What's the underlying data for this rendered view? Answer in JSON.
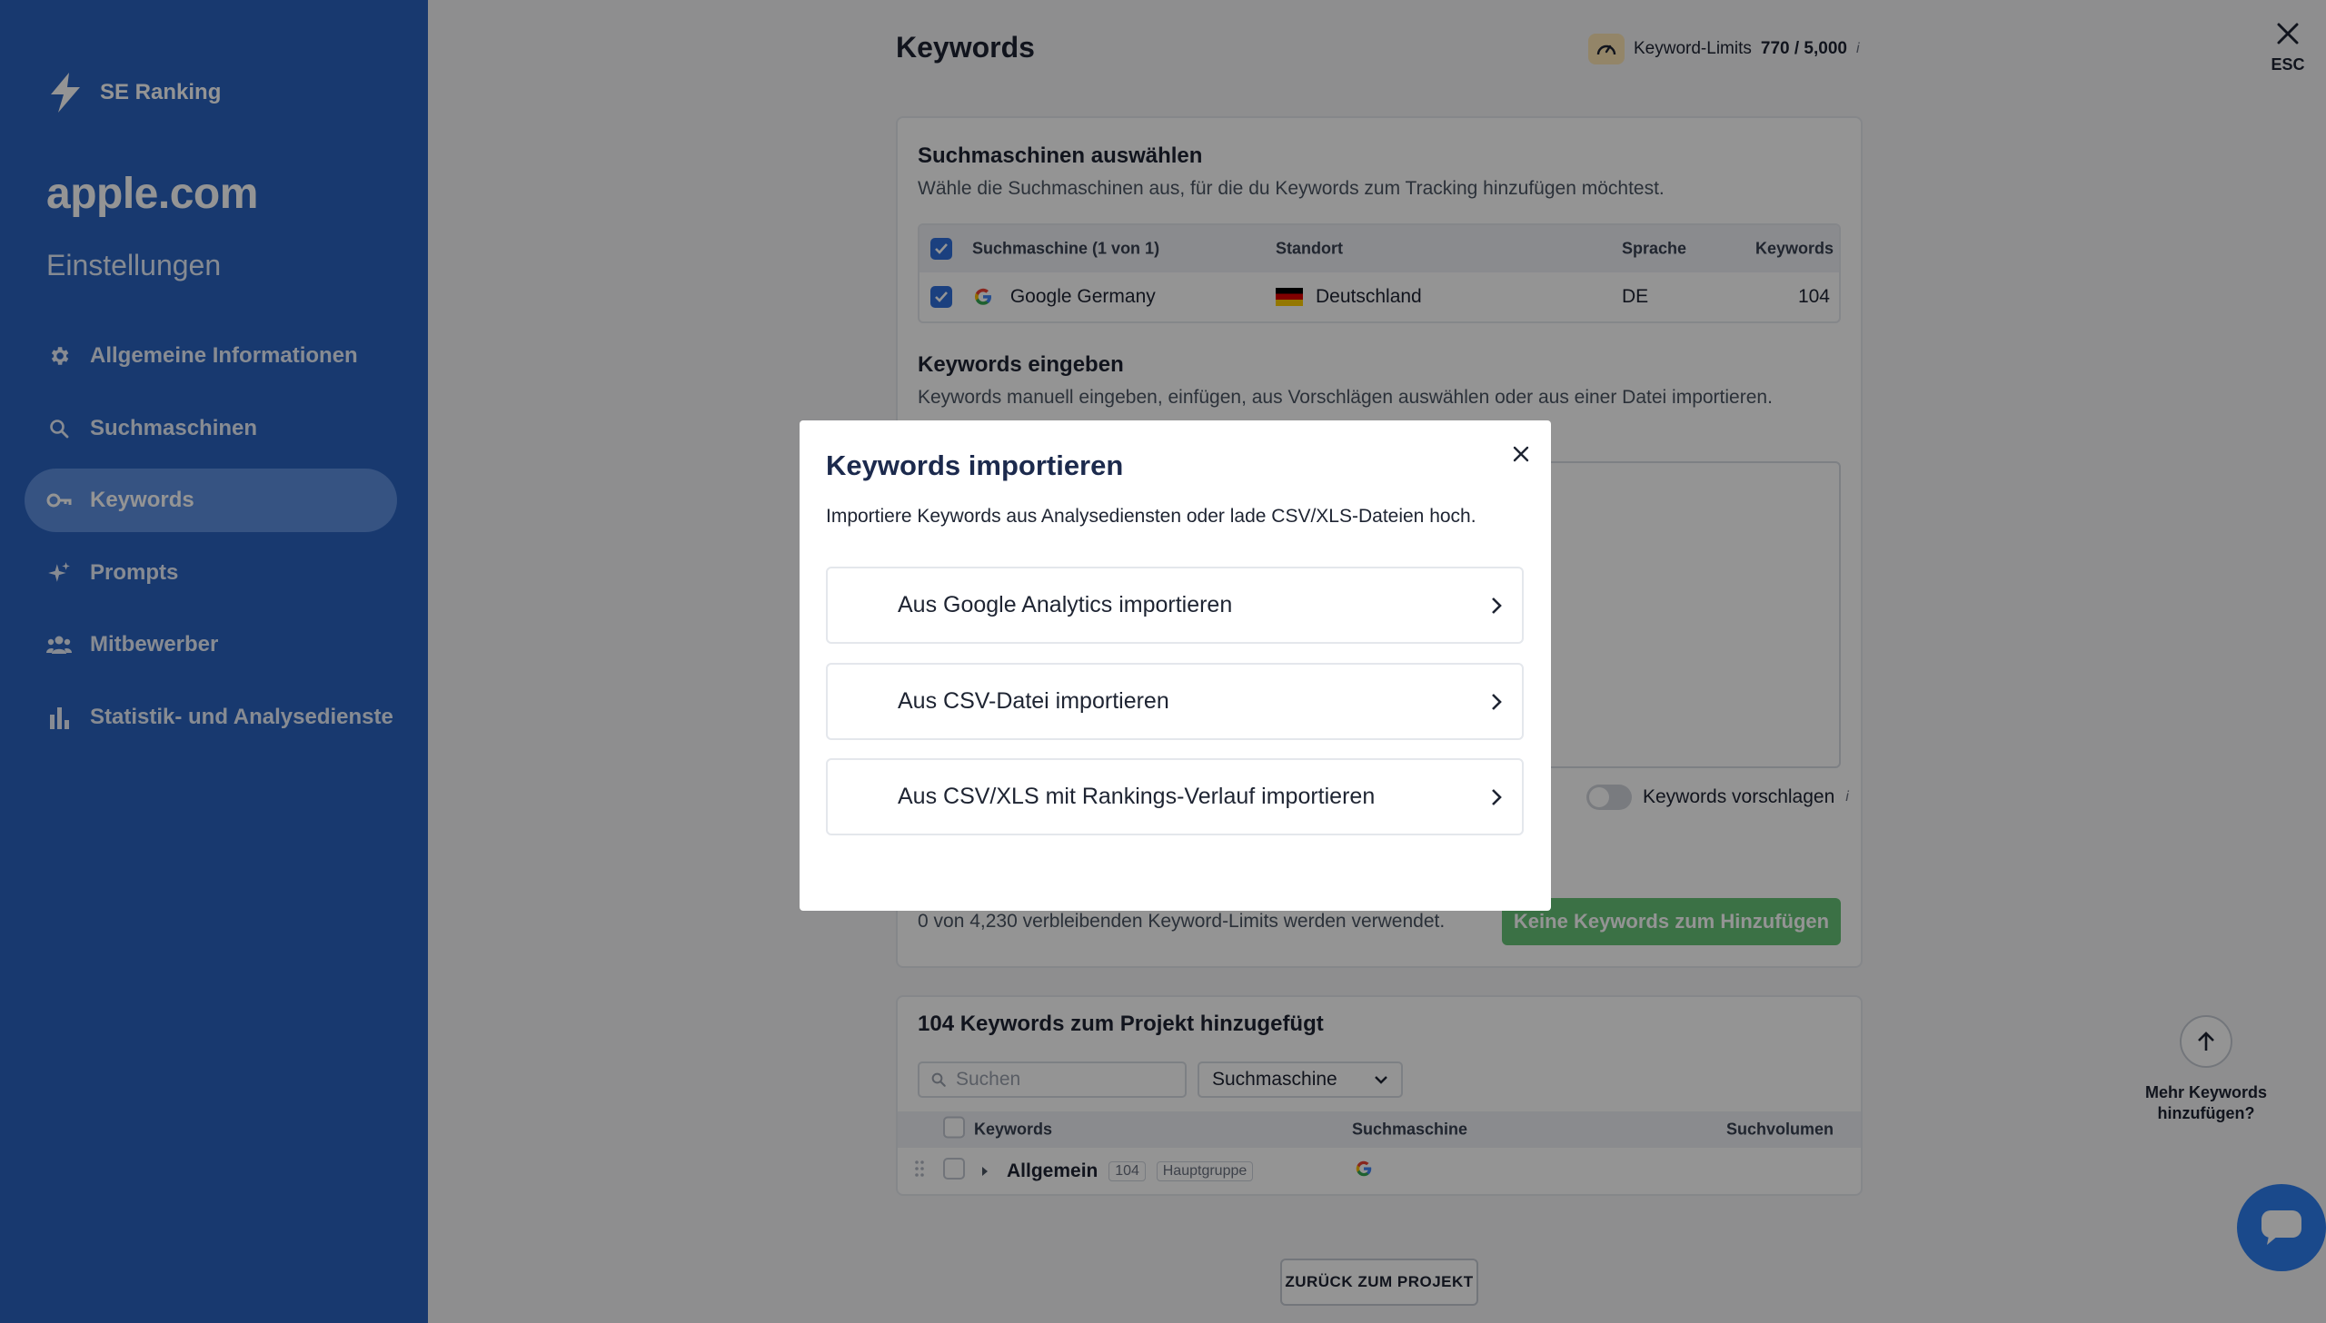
{
  "sidebar": {
    "brand": "SE Ranking",
    "project": "apple.com",
    "section": "Einstellungen",
    "items": [
      {
        "label": "Allgemeine Informationen",
        "icon": "gear-icon",
        "active": false
      },
      {
        "label": "Suchmaschinen",
        "icon": "search-icon",
        "active": false
      },
      {
        "label": "Keywords",
        "icon": "key-icon",
        "active": true
      },
      {
        "label": "Prompts",
        "icon": "sparkle-icon",
        "active": false
      },
      {
        "label": "Mitbewerber",
        "icon": "users-icon",
        "active": false
      },
      {
        "label": "Statistik- und Analysedienste",
        "icon": "bar-chart-icon",
        "active": false
      }
    ]
  },
  "header": {
    "title": "Keywords",
    "limits_label": "Keyword-Limits",
    "limits_value": "770 / 5,000",
    "info": "i",
    "esc": "ESC"
  },
  "engines": {
    "title": "Suchmaschinen auswählen",
    "desc": "Wähle die Suchmaschinen aus, für die du Keywords zum Tracking hinzufügen möchtest.",
    "columns": [
      "Suchmaschine (1 von 1)",
      "Standort",
      "Sprache",
      "Keywords"
    ],
    "row": {
      "engine": "Google Germany",
      "location": "Deutschland",
      "language": "DE",
      "keywords": "104"
    }
  },
  "input_section": {
    "title": "Keywords eingeben",
    "desc": "Keywords manuell eingeben, einfügen, aus Vorschlägen auswählen oder aus einer Datei importieren.",
    "suggest_label": "Keywords vorschlagen",
    "remaining": "0 von 4,230 verbleibenden Keyword-Limits werden verwendet.",
    "add_button": "Keine Keywords zum Hinzufügen"
  },
  "added": {
    "title": "104 Keywords zum Projekt hinzugefügt",
    "search_placeholder": "Suchen",
    "engine_filter": "Suchmaschine",
    "columns": [
      "Keywords",
      "Suchmaschine",
      "Suchvolumen"
    ],
    "group": {
      "name": "Allgemein",
      "count": "104",
      "tag": "Hauptgruppe"
    }
  },
  "back_button": "ZURÜCK ZUM PROJEKT",
  "more_keywords": "Mehr Keywords hinzufügen?",
  "modal": {
    "title": "Keywords importieren",
    "subtitle": "Importiere Keywords aus Analysediensten oder lade CSV/XLS-Dateien hoch.",
    "options": [
      "Aus Google Analytics importieren",
      "Aus CSV-Datei importieren",
      "Aus CSV/XLS mit Rankings-Verlauf importieren"
    ]
  },
  "colors": {
    "sidebar": "#2a63c0",
    "accent": "#2f6fdb",
    "success": "#34b04a"
  }
}
